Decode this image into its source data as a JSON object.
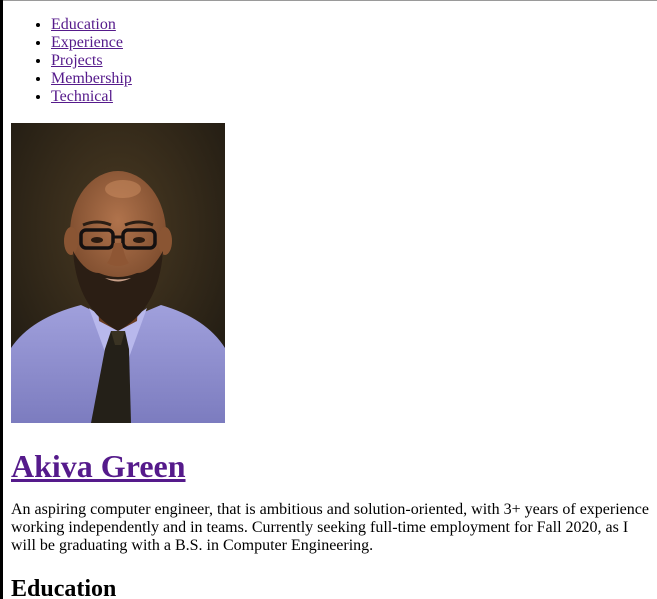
{
  "nav": {
    "items": [
      {
        "label": "Education"
      },
      {
        "label": "Experience"
      },
      {
        "label": "Projects"
      },
      {
        "label": "Membership"
      },
      {
        "label": "Technical"
      }
    ]
  },
  "profile": {
    "name": "Akiva Green",
    "summary": "An aspiring computer engineer, that is ambitious and solution-oriented, with 3+ years of experience working independently and in teams. Currently seeking full-time employment for Fall 2020, as I will be graduating with a B.S. in Computer Engineering."
  },
  "sections": {
    "education_heading": "Education"
  },
  "colors": {
    "link_visited": "#551a8b",
    "photo_background": "#2a2419",
    "shirt": "#8f8fd0"
  }
}
